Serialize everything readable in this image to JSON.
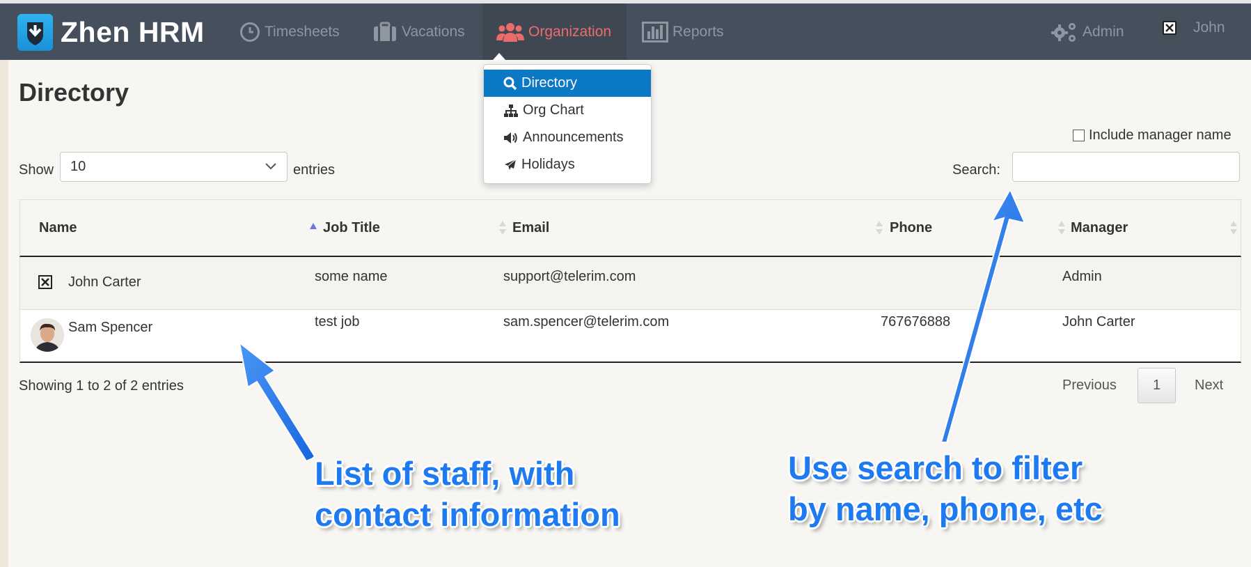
{
  "navbar": {
    "brand": "Zhen HRM",
    "items": [
      {
        "label": "Timesheets",
        "icon": "clock-icon"
      },
      {
        "label": "Vacations",
        "icon": "suitcase-icon"
      },
      {
        "label": "Organization",
        "icon": "users-icon",
        "active": true
      },
      {
        "label": "Reports",
        "icon": "bar-chart-icon"
      }
    ],
    "admin_label": "Admin",
    "user_label": "John"
  },
  "dropdown": {
    "items": [
      {
        "label": "Directory",
        "icon": "search-icon",
        "active": true
      },
      {
        "label": "Org Chart",
        "icon": "sitemap-icon"
      },
      {
        "label": "Announcements",
        "icon": "bullhorn-icon"
      },
      {
        "label": "Holidays",
        "icon": "plane-icon"
      }
    ]
  },
  "page": {
    "title": "Directory",
    "show_label": "Show",
    "entries_value": "10",
    "entries_label": "entries",
    "include_manager_label": "Include manager name",
    "search_label": "Search:",
    "search_value": ""
  },
  "table": {
    "columns": [
      "Name",
      "Job Title",
      "Email",
      "Phone",
      "Manager"
    ],
    "rows": [
      {
        "name": "John Carter",
        "job_title": "some name",
        "email": "support@telerim.com",
        "phone": "",
        "manager": "Admin"
      },
      {
        "name": "Sam Spencer",
        "job_title": "test job",
        "email": "sam.spencer@telerim.com",
        "phone": "767676888",
        "manager": "John Carter"
      }
    ]
  },
  "footer": {
    "info": "Showing 1 to 2 of 2 entries",
    "previous": "Previous",
    "current_page": "1",
    "next": "Next"
  },
  "annotations": {
    "left_line1": "List of staff, with",
    "left_line2": "contact  information",
    "right_line1": "Use search to filter",
    "right_line2": "by name, phone, etc"
  },
  "colors": {
    "navbar": "#46505c",
    "active_nav": "#ec6b6b",
    "dropdown_active": "#0b78c6",
    "callout": "#1e7af0",
    "logo": "#1a8fd8"
  }
}
